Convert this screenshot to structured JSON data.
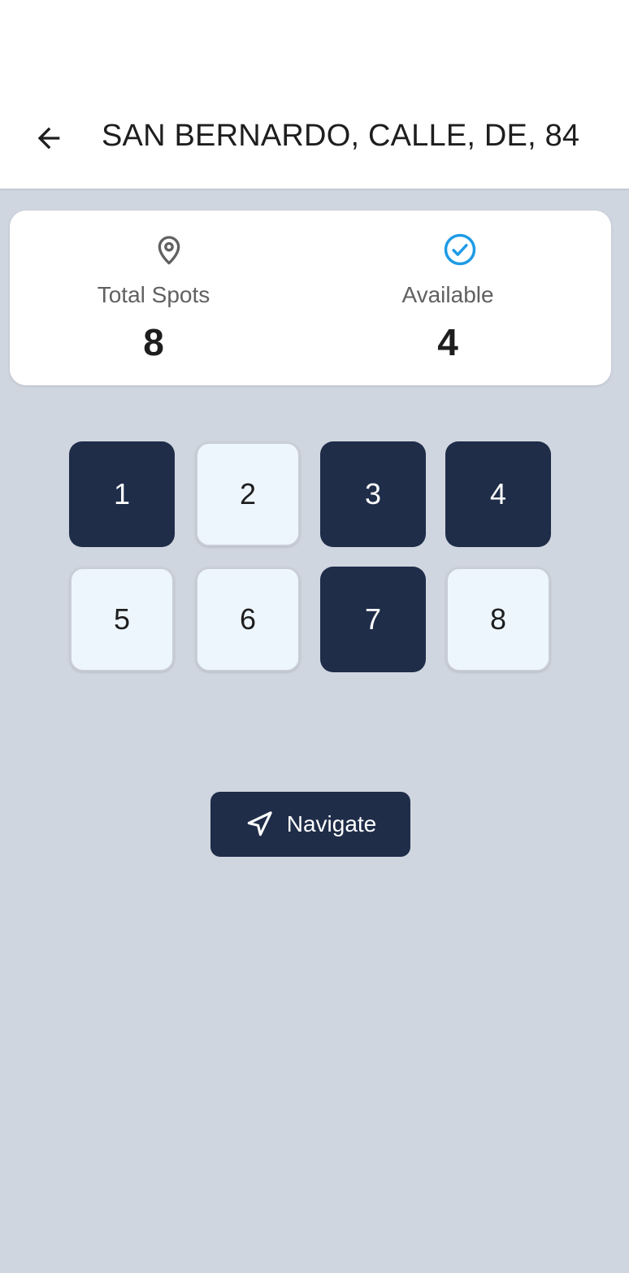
{
  "header": {
    "title": "SAN BERNARDO, CALLE, DE, 84",
    "back_icon": "arrow-left-icon"
  },
  "stats": {
    "total": {
      "icon": "map-pin-icon",
      "label": "Total Spots",
      "value": "8",
      "icon_color": "#616161"
    },
    "available": {
      "icon": "check-circle-icon",
      "label": "Available",
      "value": "4",
      "icon_color": "#1e9be6"
    }
  },
  "spots": [
    {
      "number": "1",
      "status": "occupied"
    },
    {
      "number": "2",
      "status": "free"
    },
    {
      "number": "3",
      "status": "occupied"
    },
    {
      "number": "4",
      "status": "occupied"
    },
    {
      "number": "5",
      "status": "free"
    },
    {
      "number": "6",
      "status": "free"
    },
    {
      "number": "7",
      "status": "occupied"
    },
    {
      "number": "8",
      "status": "free"
    }
  ],
  "navigate": {
    "label": "Navigate",
    "icon": "navigation-arrow-icon"
  },
  "colors": {
    "primary": "#1f2d49",
    "background": "#d0d6e0",
    "free_spot": "#eef6fd",
    "accent": "#1e9be6"
  }
}
